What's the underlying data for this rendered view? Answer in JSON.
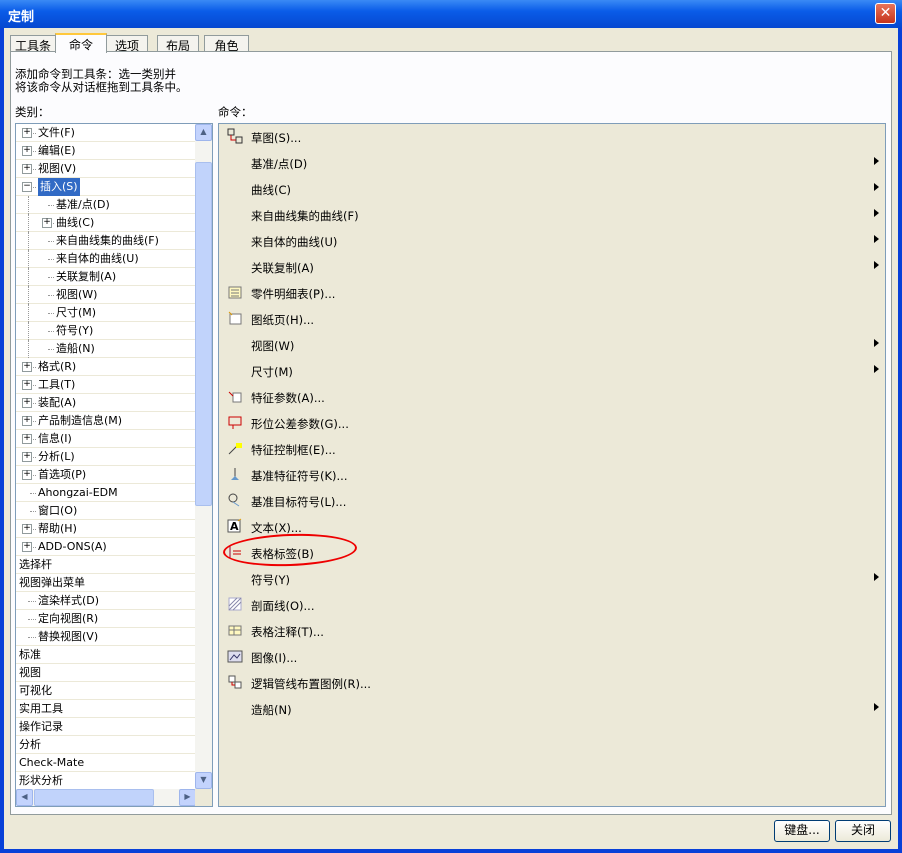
{
  "window": {
    "title": "定制"
  },
  "tabs": [
    "工具条",
    "命令",
    "选项",
    "布局",
    "角色"
  ],
  "active_tab": 1,
  "description": "添加命令到工具条：选一类别并\n将该命令从对话框拖到工具条中。",
  "category_label": "类别：",
  "command_label": "命令：",
  "categories": [
    {
      "text": "文件(F)",
      "level": 0,
      "exp": "+"
    },
    {
      "text": "编辑(E)",
      "level": 0,
      "exp": "+"
    },
    {
      "text": "视图(V)",
      "level": 0,
      "exp": "+"
    },
    {
      "text": "插入(S)",
      "level": 0,
      "exp": "-",
      "selected": true
    },
    {
      "text": "基准/点(D)",
      "level": 1
    },
    {
      "text": "曲线(C)",
      "level": 1,
      "exp": "+"
    },
    {
      "text": "来自曲线集的曲线(F)",
      "level": 1
    },
    {
      "text": "来自体的曲线(U)",
      "level": 1
    },
    {
      "text": "关联复制(A)",
      "level": 1
    },
    {
      "text": "视图(W)",
      "level": 1
    },
    {
      "text": "尺寸(M)",
      "level": 1
    },
    {
      "text": "符号(Y)",
      "level": 1
    },
    {
      "text": "造船(N)",
      "level": 1
    },
    {
      "text": "格式(R)",
      "level": 0,
      "exp": "+"
    },
    {
      "text": "工具(T)",
      "level": 0,
      "exp": "+"
    },
    {
      "text": "装配(A)",
      "level": 0,
      "exp": "+"
    },
    {
      "text": "产品制造信息(M)",
      "level": 0,
      "exp": "+"
    },
    {
      "text": "信息(I)",
      "level": 0,
      "exp": "+"
    },
    {
      "text": "分析(L)",
      "level": 0,
      "exp": "+"
    },
    {
      "text": "首选项(P)",
      "level": 0,
      "exp": "+"
    },
    {
      "text": "Ahongzai-EDM",
      "level": 0
    },
    {
      "text": "窗口(O)",
      "level": 0
    },
    {
      "text": "帮助(H)",
      "level": 0,
      "exp": "+"
    },
    {
      "text": "ADD-ONS(A)",
      "level": 0,
      "exp": "+"
    },
    {
      "text": "选择杆",
      "level": -1
    },
    {
      "text": "视图弹出菜单",
      "level": -1
    },
    {
      "text": "渲染样式(D)",
      "level": 2
    },
    {
      "text": "定向视图(R)",
      "level": 2
    },
    {
      "text": "替换视图(V)",
      "level": 2
    },
    {
      "text": "标准",
      "level": -1
    },
    {
      "text": "视图",
      "level": -1
    },
    {
      "text": "可视化",
      "level": -1
    },
    {
      "text": "实用工具",
      "level": -1
    },
    {
      "text": "操作记录",
      "level": -1
    },
    {
      "text": "分析",
      "level": -1
    },
    {
      "text": "Check-Mate",
      "level": -1
    },
    {
      "text": "形状分析",
      "level": -1
    }
  ],
  "commands": [
    {
      "text": "草图(S)...",
      "icon": "sketch-icon",
      "arrow": false
    },
    {
      "text": "基准/点(D)",
      "icon": "",
      "arrow": true
    },
    {
      "text": "曲线(C)",
      "icon": "",
      "arrow": true
    },
    {
      "text": "来自曲线集的曲线(F)",
      "icon": "",
      "arrow": true
    },
    {
      "text": "来自体的曲线(U)",
      "icon": "",
      "arrow": true
    },
    {
      "text": "关联复制(A)",
      "icon": "",
      "arrow": true
    },
    {
      "text": "零件明细表(P)...",
      "icon": "parts-list-icon",
      "arrow": false
    },
    {
      "text": "图纸页(H)...",
      "icon": "drawing-sheet-icon",
      "arrow": false
    },
    {
      "text": "视图(W)",
      "icon": "",
      "arrow": true
    },
    {
      "text": "尺寸(M)",
      "icon": "",
      "arrow": true
    },
    {
      "text": "特征参数(A)...",
      "icon": "feature-parameters-icon",
      "arrow": false
    },
    {
      "text": "形位公差参数(G)...",
      "icon": "gdt-parameters-icon",
      "arrow": false
    },
    {
      "text": "特征控制框(E)...",
      "icon": "feature-control-frame-icon",
      "arrow": false
    },
    {
      "text": "基准特征符号(K)...",
      "icon": "datum-feature-symbol-icon",
      "arrow": false
    },
    {
      "text": "基准目标符号(L)...",
      "icon": "datum-target-symbol-icon",
      "arrow": false
    },
    {
      "text": "文本(X)...",
      "icon": "text-icon",
      "arrow": false
    },
    {
      "text": "表格标签(B)",
      "icon": "table-label-icon",
      "arrow": false
    },
    {
      "text": "符号(Y)",
      "icon": "",
      "arrow": true
    },
    {
      "text": "剖面线(O)...",
      "icon": "hatch-icon",
      "arrow": false
    },
    {
      "text": "表格注释(T)...",
      "icon": "tabular-note-icon",
      "arrow": false
    },
    {
      "text": "图像(I)...",
      "icon": "image-icon",
      "arrow": false
    },
    {
      "text": "逻辑管线布置图例(R)...",
      "icon": "routing-legend-icon",
      "arrow": false
    },
    {
      "text": "造船(N)",
      "icon": "",
      "arrow": true
    }
  ],
  "buttons": {
    "keyboard": "键盘...",
    "close": "关闭"
  },
  "colors": {
    "title_bar": "#0a5ce8",
    "selection": "#316ac5",
    "annotation": "#e00000"
  }
}
